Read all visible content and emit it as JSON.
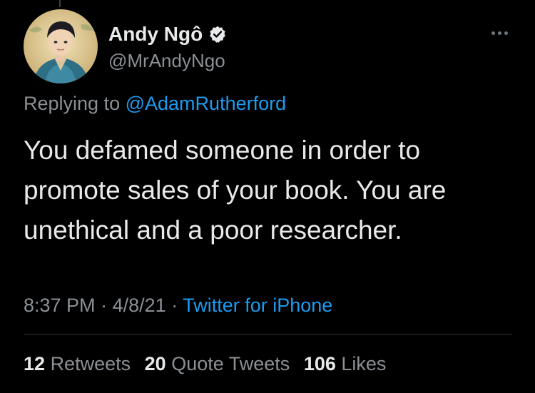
{
  "user": {
    "display_name": "Andy Ngô",
    "handle": "@MrAndyNgo",
    "verified_icon": "verified-badge-icon",
    "avatar": "avatar-illustration"
  },
  "reply": {
    "prefix": "Replying to",
    "mention": "@AdamRutherford"
  },
  "tweet": {
    "text": "You defamed someone in order to promote sales of your book. You are unethical and a poor researcher."
  },
  "meta": {
    "time": "8:37 PM",
    "separator1": "·",
    "date": "4/8/21",
    "separator2": "·",
    "source": "Twitter for iPhone"
  },
  "stats": {
    "retweets_count": "12",
    "retweets_label": "Retweets",
    "quotes_count": "20",
    "quotes_label": "Quote Tweets",
    "likes_count": "106",
    "likes_label": "Likes"
  },
  "colors": {
    "background": "#000000",
    "primary_text": "#e7e9ea",
    "secondary_text": "#8b9095",
    "accent": "#1d9bf0"
  }
}
